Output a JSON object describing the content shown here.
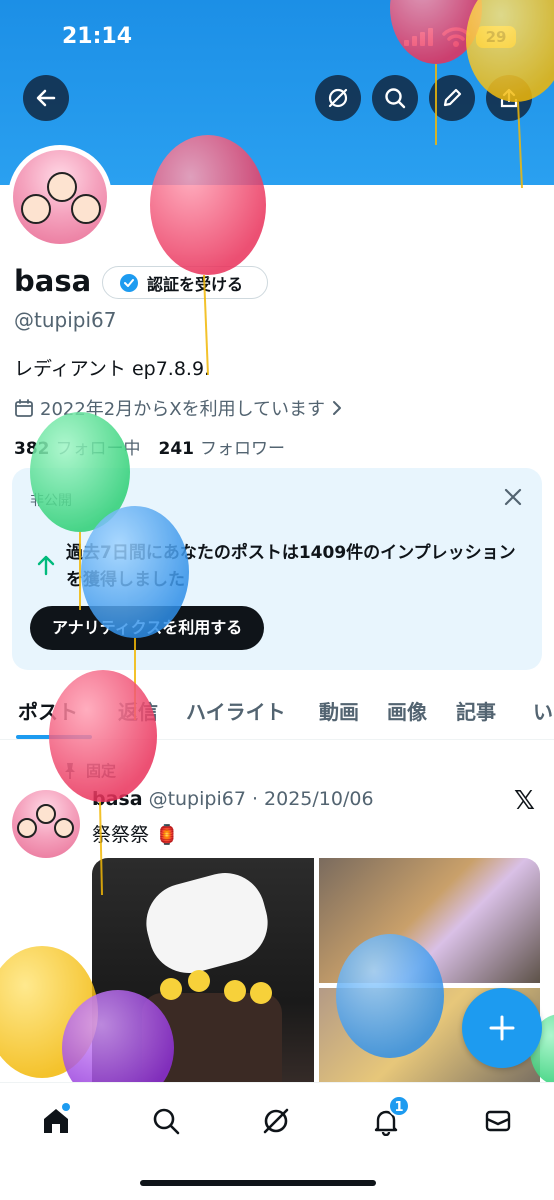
{
  "status_bar": {
    "time": "21:14",
    "battery": "29"
  },
  "profile": {
    "name": "basa",
    "verify_label": "認証を受ける",
    "handle": "@tupipi67",
    "bio": "レディアント ep7.8.9.",
    "joined": "2022年2月からXを利用しています",
    "following_count": "382",
    "following_label": "フォロー中",
    "followers_count": "241",
    "followers_label": "フォロワー"
  },
  "insight_card": {
    "private_label": "非公開",
    "message": "過去7日間にあなたのポストは1409件のインプレッションを獲得しました",
    "cta": "アナリティクスを利用する"
  },
  "tabs": [
    "ポスト",
    "返信",
    "ハイライト",
    "動画",
    "画像",
    "記事",
    "い"
  ],
  "pinned_post": {
    "pinned_label": "固定",
    "author": "basa",
    "handle_date": "@tupipi67 · 2025/10/06",
    "text": "祭祭祭 🏮",
    "x_logo": "𝕏"
  },
  "bottom_nav": {
    "notification_count": "1"
  },
  "colors": {
    "accent": "#1d9bf0",
    "banner": "#2aa0f0",
    "dark": "#0f1419"
  }
}
